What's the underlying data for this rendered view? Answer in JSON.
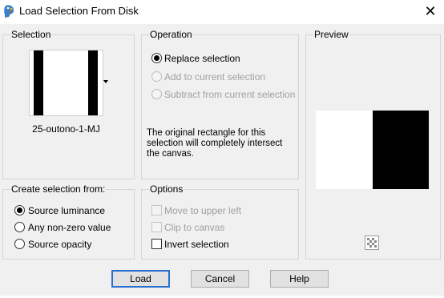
{
  "window": {
    "title": "Load Selection From Disk",
    "close_glyph": "✕"
  },
  "selection": {
    "group_label": "Selection",
    "file_name": "25-outono-1-MJ"
  },
  "operation": {
    "group_label": "Operation",
    "options": [
      {
        "label": "Replace selection",
        "checked": true,
        "enabled": true
      },
      {
        "label": "Add to current selection",
        "checked": false,
        "enabled": false
      },
      {
        "label": "Subtract from current selection",
        "checked": false,
        "enabled": false
      }
    ],
    "description": "The original rectangle for this selection will completely intersect the canvas."
  },
  "preview": {
    "group_label": "Preview"
  },
  "create_from": {
    "group_label": "Create selection from:",
    "options": [
      {
        "label": "Source luminance",
        "checked": true
      },
      {
        "label": "Any non-zero value",
        "checked": false
      },
      {
        "label": "Source opacity",
        "checked": false
      }
    ]
  },
  "options": {
    "group_label": "Options",
    "items": [
      {
        "label": "Move to upper left",
        "checked": false,
        "enabled": false
      },
      {
        "label": "Clip to canvas",
        "checked": false,
        "enabled": false
      },
      {
        "label": "Invert selection",
        "checked": false,
        "enabled": true
      }
    ]
  },
  "buttons": {
    "load": "Load",
    "cancel": "Cancel",
    "help": "Help"
  },
  "icons": {
    "app": "paint-palette-icon",
    "close": "close-icon",
    "dropdown": "dropdown-arrow-icon",
    "proof": "checkerboard-proof-icon"
  }
}
